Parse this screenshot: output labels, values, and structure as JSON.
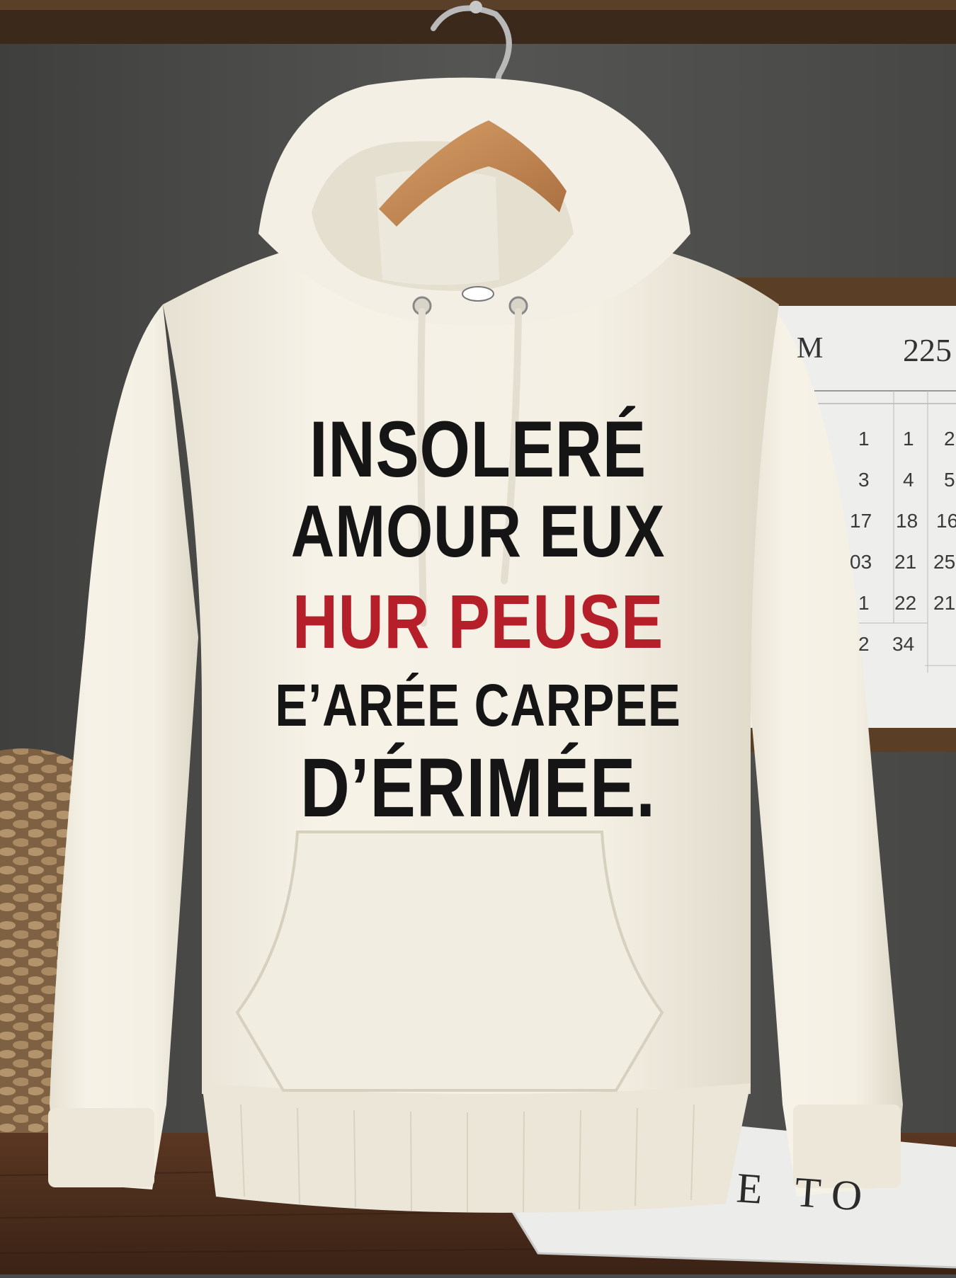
{
  "hoodie": {
    "print_lines": [
      {
        "text": "INSOLERÉ",
        "color": "#151515"
      },
      {
        "text": "AMOUR EUX",
        "color": "#151515"
      },
      {
        "text": "HUR PEUSE",
        "color": "#b51f2a"
      },
      {
        "text": "E’ARÉE CARPEE",
        "color": "#151515"
      },
      {
        "text": "D’ÉRIMÉE.",
        "color": "#151515"
      }
    ],
    "color": "#f3efe3"
  },
  "calendar": {
    "header_left": "M",
    "header_right": "225",
    "numbers": [
      "1",
      "1",
      "2",
      "3",
      "4",
      "5",
      "17",
      "18",
      "16",
      "03",
      "21",
      "25",
      "1",
      "22",
      "21",
      "2",
      "34"
    ]
  },
  "newspaper": {
    "text": "E TO"
  },
  "colors": {
    "wall": "#4a4a48",
    "shelf": "#3b2a1c",
    "table": "#4b2e1d",
    "hanger": "#c48a55",
    "basket": "#9b7b55"
  }
}
